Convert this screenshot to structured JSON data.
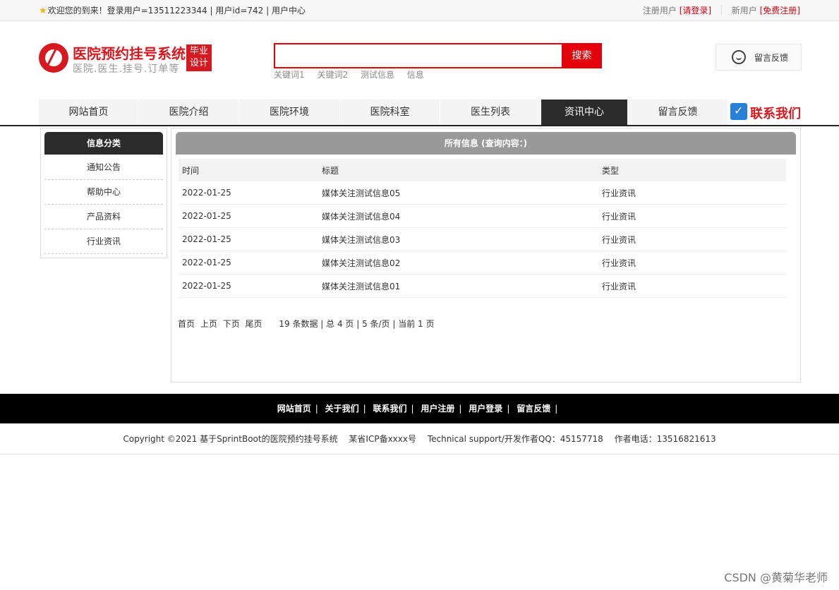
{
  "topbar": {
    "welcome": "欢迎您的到来！登录用户=13511223344 | 用户id=742 | 用户中心",
    "register_user": "注册用户",
    "please_login": "[请登录]",
    "new_user": "新用户",
    "free_register": "[免费注册]"
  },
  "logo": {
    "title": "医院预约挂号系统",
    "subtitle": "医院.医生.挂号.订单等",
    "badge_line1": "毕业",
    "badge_line2": "设计"
  },
  "search": {
    "placeholder": "",
    "button": "搜索",
    "keywords": [
      "关键词1",
      "关键词2",
      "测试信息",
      "信息"
    ]
  },
  "feedback_button": "留言反馈",
  "nav": {
    "items": [
      "网站首页",
      "医院介绍",
      "医院环境",
      "医院科室",
      "医生列表",
      "资讯中心",
      "留言反馈"
    ],
    "active_index": 5,
    "contact": "联系我们"
  },
  "sidebar": {
    "title": "信息分类",
    "items": [
      "通知公告",
      "帮助中心",
      "产品资料",
      "行业资讯"
    ]
  },
  "main": {
    "title": "所有信息 (查询内容：)",
    "columns": [
      "时间",
      "标题",
      "类型"
    ],
    "rows": [
      [
        "2022-01-25",
        "媒体关注测试信息05",
        "行业资讯"
      ],
      [
        "2022-01-25",
        "媒体关注测试信息04",
        "行业资讯"
      ],
      [
        "2022-01-25",
        "媒体关注测试信息03",
        "行业资讯"
      ],
      [
        "2022-01-25",
        "媒体关注测试信息02",
        "行业资讯"
      ],
      [
        "2022-01-25",
        "媒体关注测试信息01",
        "行业资讯"
      ]
    ],
    "pager": {
      "first": "首页",
      "prev": "上页",
      "next": "下页",
      "last": "尾页",
      "stats": "19 条数据 | 总 4 页 | 5 条/页 | 当前 1 页"
    }
  },
  "footer": {
    "links": [
      "网站首页",
      "关于我们",
      "联系我们",
      "用户注册",
      "用户登录",
      "留言反馈"
    ],
    "copyright": "Copyright ©2021 基于SprintBoot的医院预约挂号系统",
    "icp": "某省ICP备xxxx号",
    "support": "Technical support/开发作者QQ：45157718",
    "phone": "作者电话：13516821613"
  },
  "watermark": "CSDN @黄菊华老师",
  "colors": {
    "accent": "#e3000b",
    "nav_active": "#2b2b2b"
  }
}
